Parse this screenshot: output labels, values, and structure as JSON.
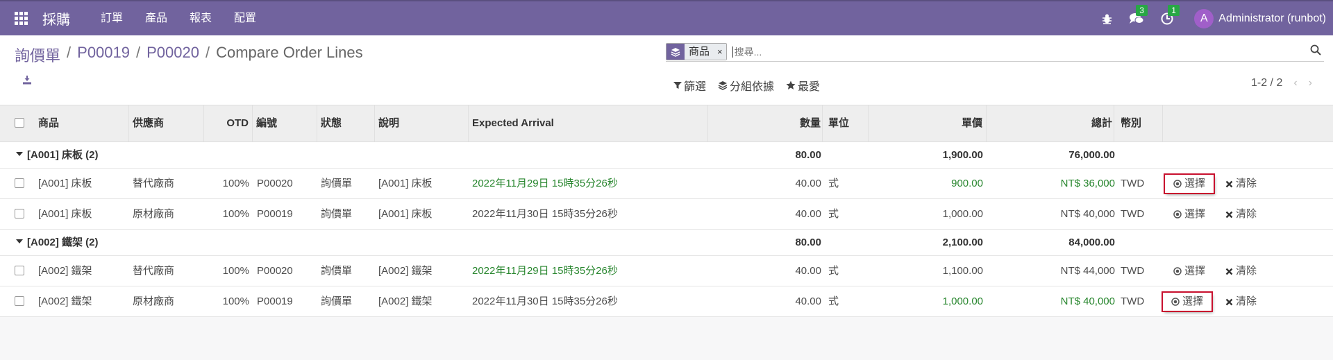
{
  "topbar": {
    "app_name": "採購",
    "menu": [
      "訂單",
      "產品",
      "報表",
      "配置"
    ],
    "messages_badge": "3",
    "activities_badge": "1",
    "avatar_letter": "A",
    "username": "Administrator (runbot)",
    "bar_color": "#71639e"
  },
  "breadcrumb": {
    "items": [
      "詢價單",
      "P00019",
      "P00020"
    ],
    "current": "Compare Order Lines",
    "separator": "/"
  },
  "search": {
    "facet_value": "商品",
    "facet_remove": "×",
    "placeholder": "搜尋..."
  },
  "filters": {
    "filter_label": "篩選",
    "groupby_label": "分組依據",
    "favorites_label": "最愛"
  },
  "pager": {
    "value": "1-2 / 2",
    "prev": "‹",
    "next": "›"
  },
  "columns": {
    "product": "商品",
    "vendor": "供應商",
    "otd": "OTD",
    "number": "編號",
    "status": "狀態",
    "description": "說明",
    "expected": "Expected Arrival",
    "qty": "數量",
    "uom": "單位",
    "unit_price": "單價",
    "total": "總計",
    "currency": "幣別"
  },
  "groups": [
    {
      "label": "[A001] 床板 (2)",
      "qty": "80.00",
      "unit_price": "1,900.00",
      "total": "76,000.00",
      "rows": [
        {
          "product": "[A001] 床板",
          "vendor": "替代廠商",
          "otd": "100%",
          "number": "P00020",
          "status": "詢價單",
          "description": "[A001] 床板",
          "expected": "2022年11月29日 15時35分26秒",
          "qty": "40.00",
          "uom": "式",
          "unit_price": "900.00",
          "total": "NT$ 36,000",
          "currency": "TWD",
          "select": "選擇",
          "clear": "清除"
        },
        {
          "product": "[A001] 床板",
          "vendor": "原材廠商",
          "otd": "100%",
          "number": "P00019",
          "status": "詢價單",
          "description": "[A001] 床板",
          "expected": "2022年11月30日 15時35分26秒",
          "qty": "40.00",
          "uom": "式",
          "unit_price": "1,000.00",
          "total": "NT$ 40,000",
          "currency": "TWD",
          "select": "選擇",
          "clear": "清除"
        }
      ]
    },
    {
      "label": "[A002] 鐵架 (2)",
      "qty": "80.00",
      "unit_price": "2,100.00",
      "total": "84,000.00",
      "rows": [
        {
          "product": "[A002] 鐵架",
          "vendor": "替代廠商",
          "otd": "100%",
          "number": "P00020",
          "status": "詢價單",
          "description": "[A002] 鐵架",
          "expected": "2022年11月29日 15時35分26秒",
          "qty": "40.00",
          "uom": "式",
          "unit_price": "1,100.00",
          "total": "NT$ 44,000",
          "currency": "TWD",
          "select": "選擇",
          "clear": "清除"
        },
        {
          "product": "[A002] 鐵架",
          "vendor": "原材廠商",
          "otd": "100%",
          "number": "P00019",
          "status": "詢價單",
          "description": "[A002] 鐵架",
          "expected": "2022年11月30日 15時35分26秒",
          "qty": "40.00",
          "uom": "式",
          "unit_price": "1,000.00",
          "total": "NT$ 40,000",
          "currency": "TWD",
          "select": "選擇",
          "clear": "清除"
        }
      ]
    }
  ]
}
